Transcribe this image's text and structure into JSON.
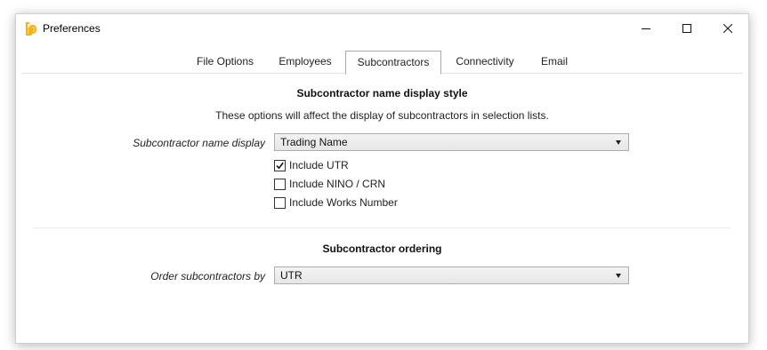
{
  "window": {
    "title": "Preferences",
    "minimize_icon": "minimize-icon",
    "maximize_icon": "maximize-icon",
    "close_icon": "close-icon"
  },
  "tabs": [
    {
      "label": "File Options",
      "active": false
    },
    {
      "label": "Employees",
      "active": false
    },
    {
      "label": "Subcontractors",
      "active": true
    },
    {
      "label": "Connectivity",
      "active": false
    },
    {
      "label": "Email",
      "active": false
    }
  ],
  "display_section": {
    "title": "Subcontractor name display style",
    "description": "These options will affect the display of subcontractors in selection lists.",
    "field_label": "Subcontractor name display",
    "selected_value": "Trading Name",
    "checkboxes": [
      {
        "label": "Include UTR",
        "checked": true
      },
      {
        "label": "Include NINO / CRN",
        "checked": false
      },
      {
        "label": "Include Works Number",
        "checked": false
      }
    ]
  },
  "ordering_section": {
    "title": "Subcontractor ordering",
    "field_label": "Order subcontractors by",
    "selected_value": "UTR"
  },
  "colors": {
    "app_icon": "#f5b21a",
    "border": "#adadad"
  }
}
